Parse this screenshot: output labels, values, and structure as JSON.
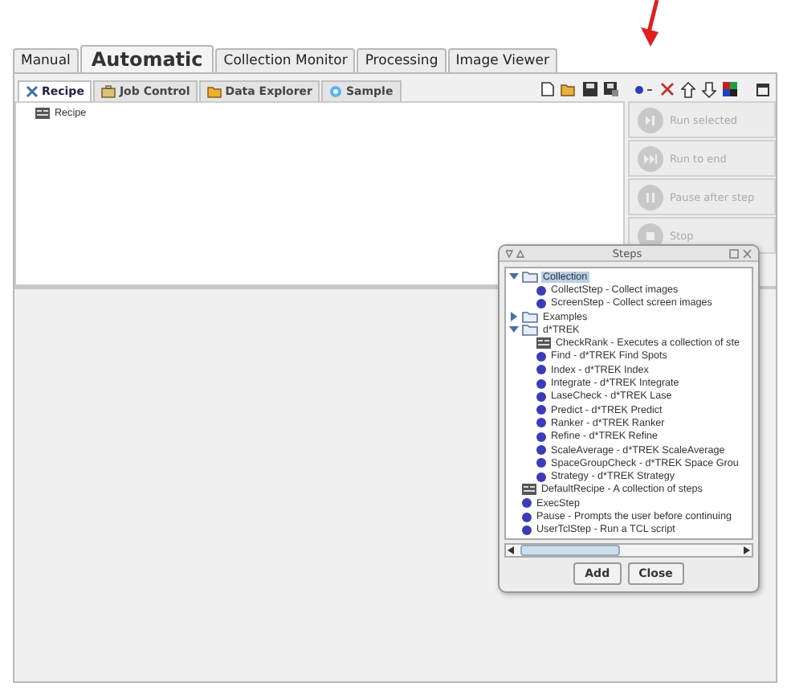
{
  "main_tabs": [
    {
      "label": "Manual",
      "selected": false
    },
    {
      "label": "Automatic",
      "selected": true
    },
    {
      "label": "Collection Monitor",
      "selected": false
    },
    {
      "label": "Processing",
      "selected": false
    },
    {
      "label": "Image Viewer",
      "selected": false
    }
  ],
  "sub_tabs": [
    {
      "label": "Recipe",
      "selected": true,
      "kind": "recipe"
    },
    {
      "label": "Job Control",
      "selected": false,
      "kind": "job"
    },
    {
      "label": "Data Explorer",
      "selected": false,
      "kind": "data"
    },
    {
      "label": "Sample",
      "selected": false,
      "kind": "sample"
    }
  ],
  "recipe_tree": [
    {
      "label": "Recipe",
      "kind": "recipe"
    }
  ],
  "run_buttons": [
    {
      "label": "Run selected",
      "kind": "play",
      "disabled": true
    },
    {
      "label": "Run to end",
      "kind": "forward",
      "disabled": true
    },
    {
      "label": "Pause after step",
      "kind": "pause",
      "disabled": true
    },
    {
      "label": "Stop",
      "kind": "stop",
      "disabled": true
    }
  ],
  "steps_dialog": {
    "title": "Steps",
    "tree": [
      {
        "label": "Collection",
        "kind": "folder",
        "expanded": true,
        "selected": true,
        "children": [
          {
            "label": "CollectStep - Collect images",
            "kind": "step",
            "selected": false
          },
          {
            "label": "ScreenStep - Collect screen images",
            "kind": "step",
            "selected": false
          }
        ]
      },
      {
        "label": "Examples",
        "kind": "folder",
        "expanded": false,
        "selected": false
      },
      {
        "label": "d*TREK",
        "kind": "folder",
        "expanded": true,
        "selected": false,
        "children": [
          {
            "label": "CheckRank - Executes a collection of ste",
            "kind": "recipe",
            "selected": false
          },
          {
            "label": "Find - d*TREK Find Spots",
            "kind": "step",
            "selected": false
          },
          {
            "label": "Index - d*TREK Index",
            "kind": "step",
            "selected": false
          },
          {
            "label": "Integrate - d*TREK Integrate",
            "kind": "step",
            "selected": false
          },
          {
            "label": "LaseCheck - d*TREK Lase",
            "kind": "step",
            "selected": false
          },
          {
            "label": "Predict - d*TREK Predict",
            "kind": "step",
            "selected": false
          },
          {
            "label": "Ranker - d*TREK Ranker",
            "kind": "step",
            "selected": false
          },
          {
            "label": "Refine - d*TREK Refine",
            "kind": "step",
            "selected": false
          },
          {
            "label": "ScaleAverage - d*TREK ScaleAverage",
            "kind": "step",
            "selected": false
          },
          {
            "label": "SpaceGroupCheck - d*TREK Space Grou",
            "kind": "step",
            "selected": false
          },
          {
            "label": "Strategy - d*TREK Strategy",
            "kind": "step",
            "selected": false
          }
        ]
      },
      {
        "label": "DefaultRecipe - A collection of steps",
        "kind": "recipe",
        "selected": false
      },
      {
        "label": "ExecStep",
        "kind": "step",
        "selected": false
      },
      {
        "label": "Pause - Prompts the user before continuing",
        "kind": "step",
        "selected": false
      },
      {
        "label": "UserTclStep - Run a TCL script",
        "kind": "step",
        "selected": false
      }
    ],
    "buttons": [
      "Add",
      "Close"
    ]
  }
}
